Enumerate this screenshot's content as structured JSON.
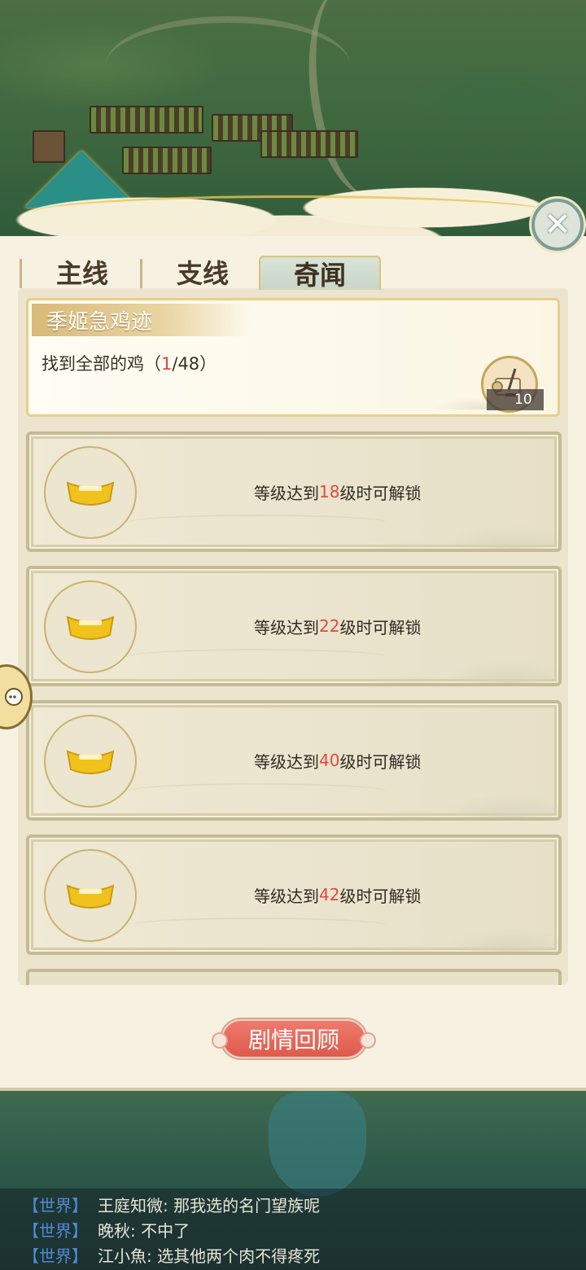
{
  "tabs": {
    "main": "主线",
    "side": "支线",
    "curiosity": "奇闻"
  },
  "quest": {
    "title": "季姬急鸡迹",
    "desc_prefix": "找到全部的鸡（",
    "progress_current": "1",
    "progress_sep": "/48）",
    "reward_count": "10",
    "reward_icon": "scroll-icon"
  },
  "locked_slots": [
    {
      "prefix": "等级达到",
      "level": "18",
      "suffix": "级时可解锁"
    },
    {
      "prefix": "等级达到",
      "level": "22",
      "suffix": "级时可解锁"
    },
    {
      "prefix": "等级达到",
      "level": "40",
      "suffix": "级时可解锁"
    },
    {
      "prefix": "等级达到",
      "level": "42",
      "suffix": "级时可解锁"
    }
  ],
  "review_button": "剧情回顾",
  "close_icon": "close-icon",
  "chat": [
    {
      "channel": "【世界】",
      "text": "王庭知微: 那我选的名门望族呢"
    },
    {
      "channel": "【世界】",
      "text": "晚秋: 不中了"
    },
    {
      "channel": "【世界】",
      "text": "江小魚: 选其他两个肉不得疼死"
    }
  ],
  "colors": {
    "panel_bg": "#f7f1e2",
    "level_highlight": "#e04a3e",
    "review_button": "#de5a4c",
    "chat_channel": "#4f8ad6"
  }
}
